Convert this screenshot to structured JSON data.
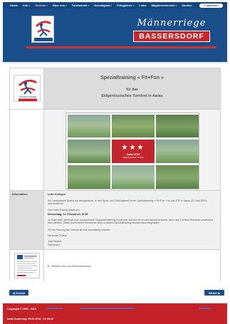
{
  "colors": {
    "header_blue": "#1b4f8c",
    "accent_red": "#c8262d",
    "footer_red": "#c22228"
  },
  "nav": {
    "items": [
      {
        "label": "Home",
        "caret": false,
        "active": false
      },
      {
        "label": "Info",
        "caret": true,
        "active": false
      },
      {
        "label": "Termine",
        "caret": true,
        "active": true
      },
      {
        "label": "Über uns",
        "caret": true,
        "active": false
      },
      {
        "label": "Turnbetrieb",
        "caret": true,
        "active": false
      },
      {
        "label": "Geselligkeit",
        "caret": true,
        "active": false
      },
      {
        "label": "Fotogalerie",
        "caret": true,
        "active": false
      },
      {
        "label": "Links",
        "caret": false,
        "active": false
      },
      {
        "label": "Mitgliederbereich",
        "caret": true,
        "active": false
      },
      {
        "label": "Suchen",
        "caret": false,
        "active": false
      }
    ],
    "login_label": "abmelden",
    "login_icon": "user-icon"
  },
  "brand": {
    "title": "Männerriege",
    "subtitle": "BASSERSDORF"
  },
  "event": {
    "title": "Spezialtraining « Fit+Fun »",
    "sub1": "für das",
    "sub2": "Eidgenössisches Turnfest in Aarau",
    "logo_caption": "Männerriege"
  },
  "collage": {
    "center_text": "Aarau 2019",
    "center_sub": "Eidgenössisches Turnfest"
  },
  "info": {
    "label": "Information:",
    "greeting": "Liebe Kollegen",
    "para1": "Am Lebendswert Abend am erfolgreichen, in den Sport- und Frühlingstreff ist ein Spezialtraining « Fit+Fun » für das ETF in Aarau (21 Juni 2019) durchzuführen.",
    "para2": "Das Linke Training findet am",
    "date_line": "Donnerstag, 21. Februar um 19:30",
    "para3": "im Hubli statt, damit wir eine provisorische Gruppeneinteilung vornehmen können ist es sehr wünschenswert, wenn das Turnfest-Reminder-anwesend sein könnten. Gäste auch! Nebst Teilnehmer sind zu diesem Spezialtraining herzlich dazu eingeladen.",
    "para4": "Für die Planung der Leitenis ist eine Anmeldung hilfreich.",
    "closing": "Herzliche Grüsse",
    "sig1": "José Nadina",
    "sig2": "Oberturner"
  },
  "attachment": {
    "arrow_icon": "arrow-right-icon",
    "link_text": "direkter Link zum Anmeldeformular"
  },
  "pager": {
    "back_label": "◀ Zurück",
    "next_label": "Weiter ▶"
  },
  "footer": {
    "copyright": "Copyright © 1999 - 2019",
    "last_change": "letzte Änderung: 09.01.2019 - 12:09:46"
  }
}
